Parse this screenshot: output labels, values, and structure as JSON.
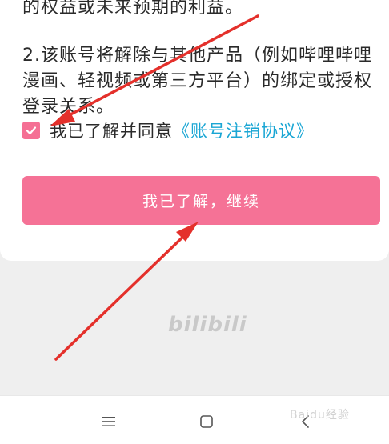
{
  "notice": {
    "line_continued": "的权益或未来预期的利益。",
    "point_2": "2.该账号将解除与其他产品（例如哔哩哔哩漫画、轻视频或第三方平台）的绑定或授权登录关系。"
  },
  "agreement": {
    "checked": true,
    "label": "我已了解并同意",
    "link_text": "《账号注销协议》"
  },
  "continue_button": {
    "label": "我已了解，继续"
  },
  "brand": {
    "logo_text": "bilibili"
  },
  "watermark": {
    "text": "Baidu经验"
  },
  "navbar": {
    "items": [
      "menu-icon",
      "home-square-icon",
      "back-chevron-icon"
    ]
  },
  "colors": {
    "accent_pink": "#f57296",
    "link_blue": "#1aa6d4",
    "annotation_red": "#e4302b"
  }
}
